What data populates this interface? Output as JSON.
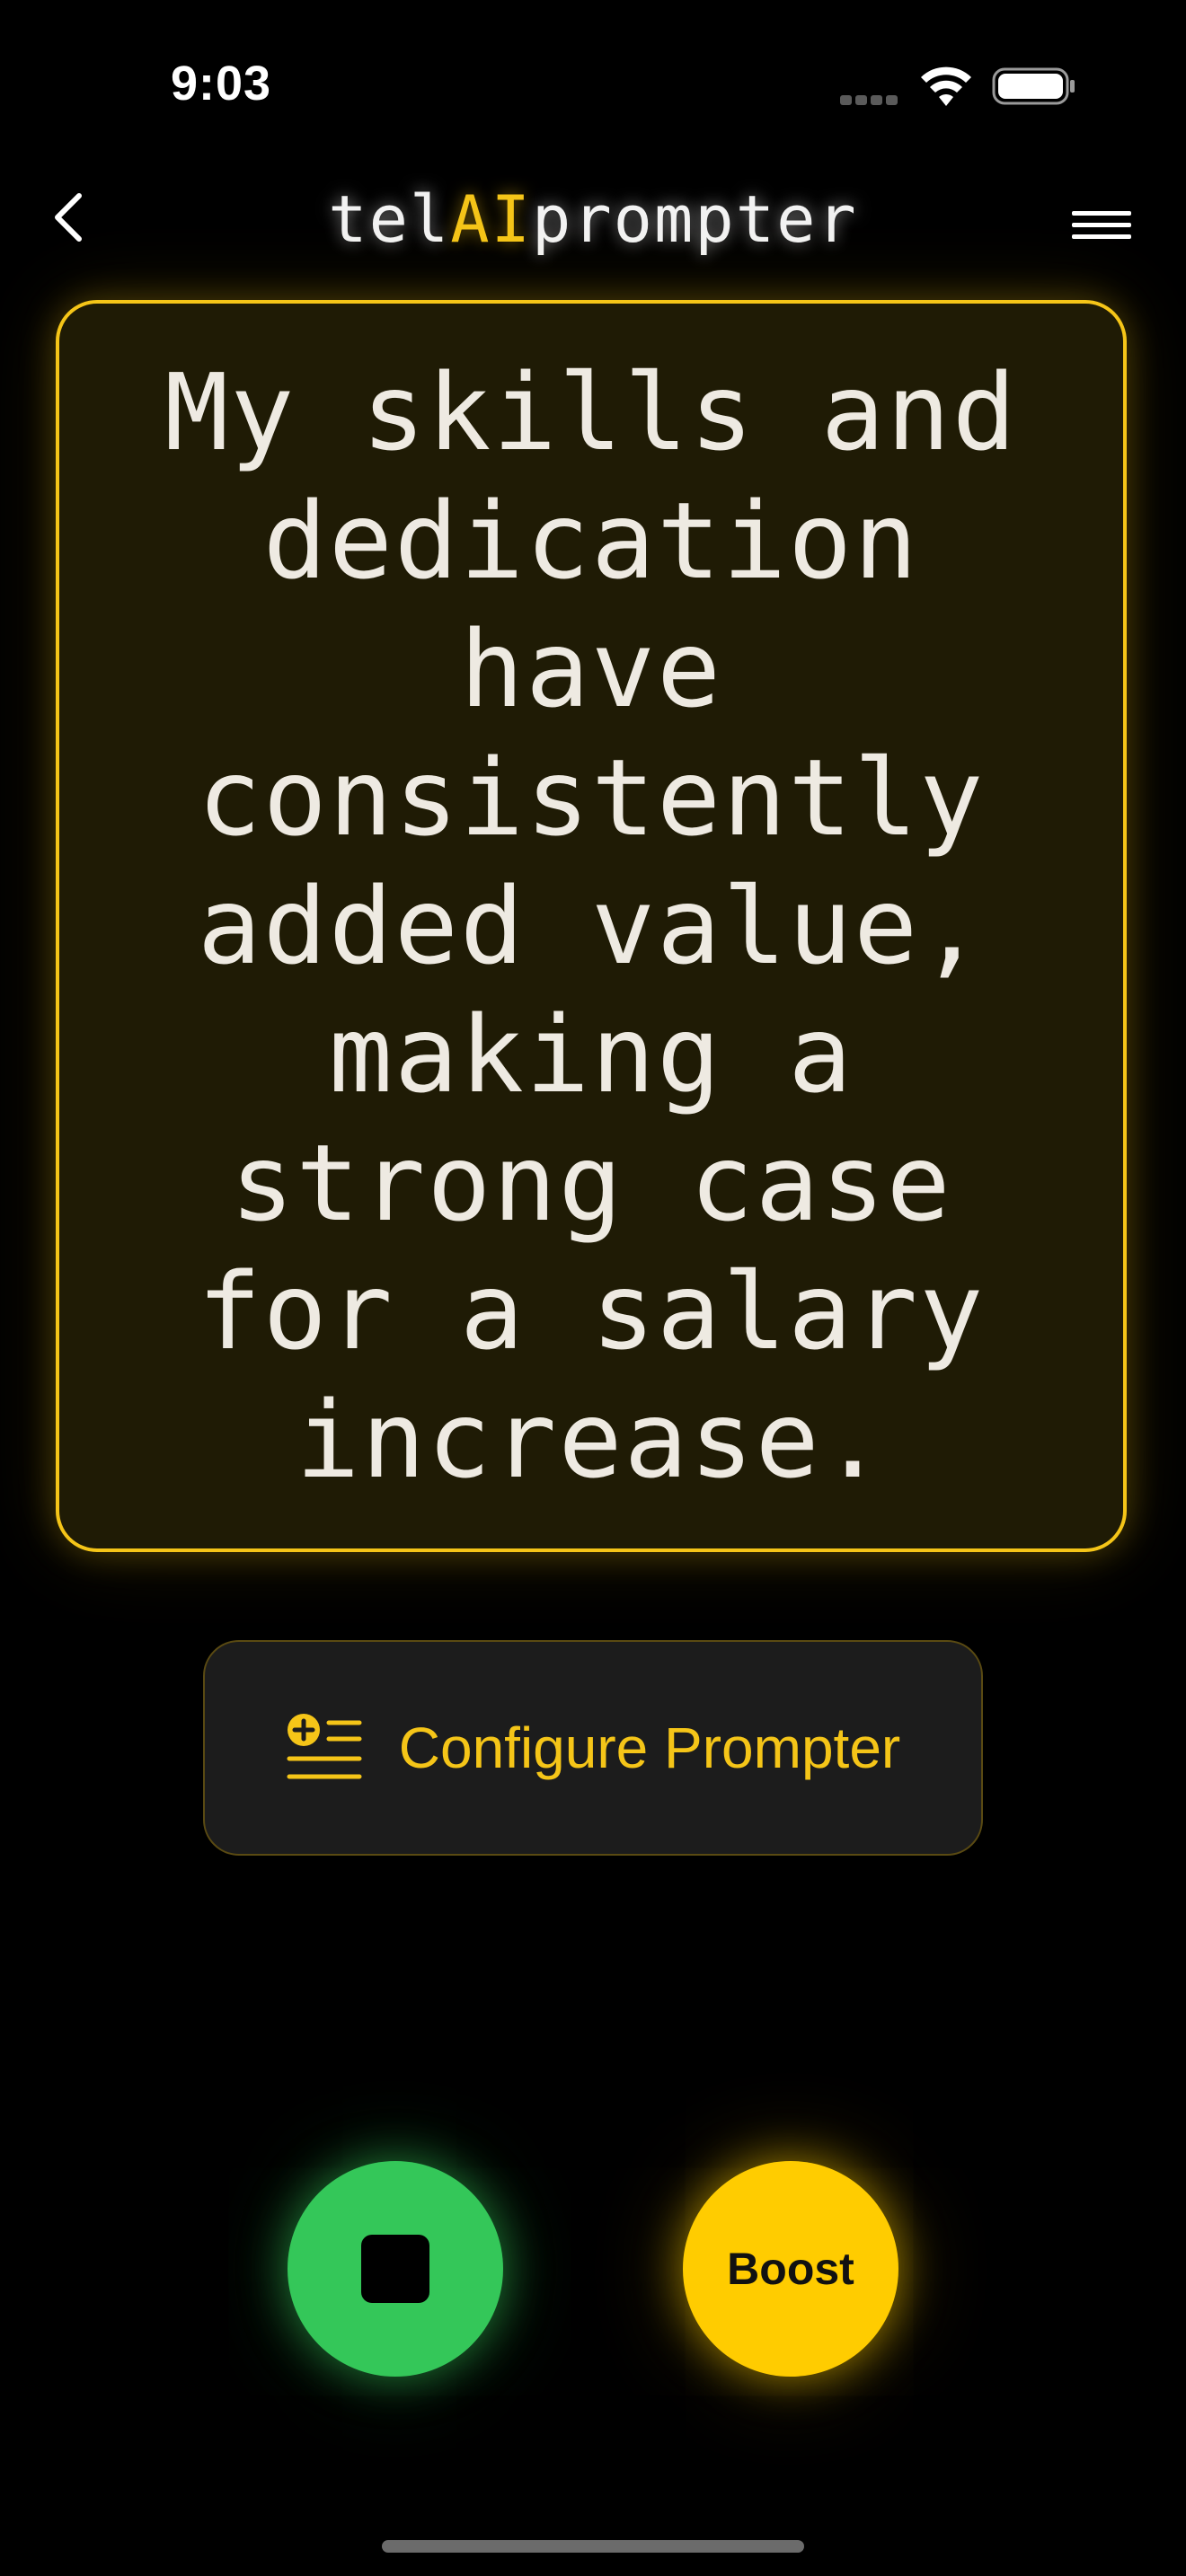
{
  "status_bar": {
    "time": "9:03",
    "signal_icon": "signal-dots-icon",
    "wifi_icon": "wifi-icon",
    "battery_icon": "battery-icon"
  },
  "nav": {
    "back_icon": "chevron-left-icon",
    "title_prefix": "tel",
    "title_accent": "AI",
    "title_suffix": "prompter",
    "menu_icon": "hamburger-menu-icon"
  },
  "prompter": {
    "text": "My skills and dedication have consistently added value, making a strong case for a salary increase."
  },
  "configure": {
    "label": "Configure Prompter",
    "icon": "list-add-icon"
  },
  "controls": {
    "stop_icon": "stop-icon",
    "boost_label": "Boost"
  },
  "colors": {
    "accent_yellow": "#f5c518",
    "prompter_bg": "#1f1b05",
    "stop_green": "#34c759",
    "boost_yellow": "#ffcc00",
    "background": "#000000"
  }
}
